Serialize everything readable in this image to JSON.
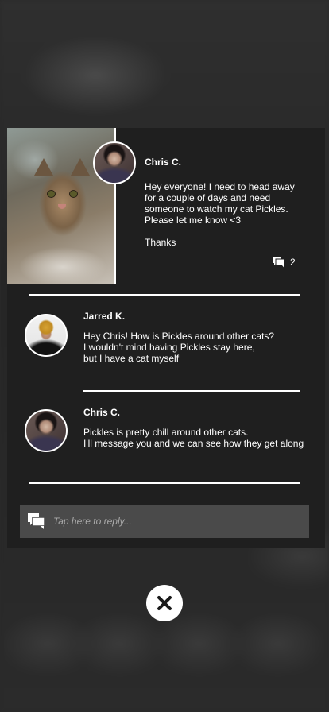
{
  "post": {
    "author": "Chris C.",
    "body": "Hey everyone! I need to head away\nfor a couple of days and need\nsomeone to watch my cat Pickles.\nPlease let me know <3\n\nThanks",
    "comment_count": "2",
    "photo_icon": "cat-photo",
    "comment_icon": "comments-icon"
  },
  "replies": [
    {
      "author": "Jarred K.",
      "body": "Hey Chris! How is Pickles around other cats?\nI wouldn't mind having Pickles stay here,\nbut I have a cat myself"
    },
    {
      "author": "Chris C.",
      "body": "Pickles is pretty chill around other cats.\nI'll message you and we can see how they get along"
    }
  ],
  "reply_bar": {
    "placeholder": "Tap here to reply...",
    "value": "",
    "icon": "comments-icon"
  },
  "close": {
    "icon": "close-icon"
  },
  "colors": {
    "modal_bg": "#1f1f1f",
    "reply_bg": "#4a4a4a",
    "text": "#ffffff",
    "placeholder": "#a9a9a9"
  }
}
